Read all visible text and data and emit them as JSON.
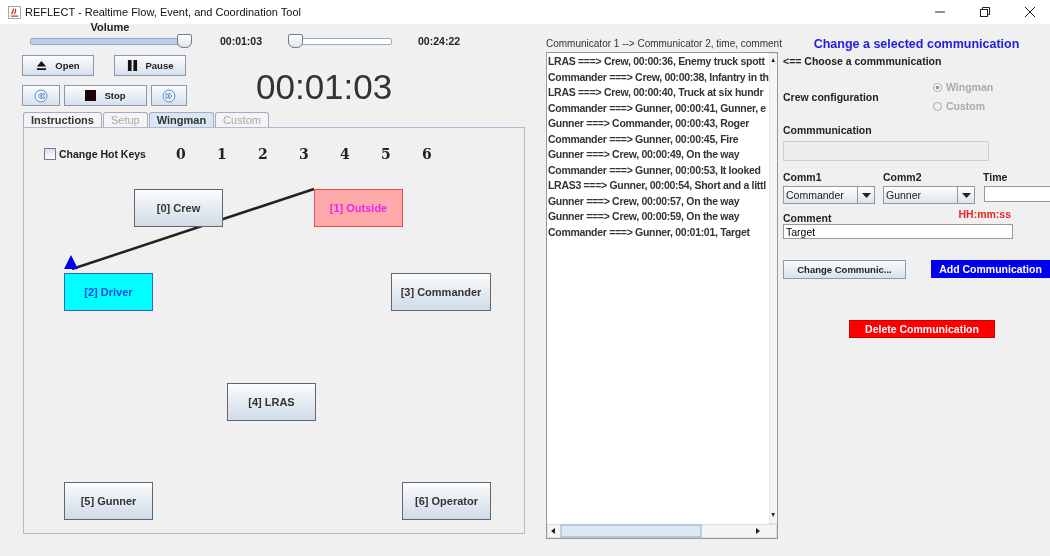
{
  "window": {
    "title": "REFLECT - Realtime Flow, Event, and Coordination Tool"
  },
  "player": {
    "volume": {
      "label": "Volume",
      "level": 0.97
    },
    "position": {
      "level": 0.04
    },
    "elapsed": "00:01:03",
    "total": "00:24:22",
    "clock": "00:01:03",
    "buttons": [
      {
        "kind": "open",
        "label": "Open"
      },
      {
        "kind": "pause",
        "label": "Pause"
      },
      {
        "kind": "rewind"
      },
      {
        "kind": "stop",
        "label": "Stop"
      },
      {
        "kind": "forward"
      }
    ]
  },
  "tabs": [
    {
      "label": "Instructions",
      "selected": false,
      "disabled": false
    },
    {
      "label": "Setup",
      "selected": false,
      "disabled": true
    },
    {
      "label": "Wingman",
      "selected": true,
      "disabled": false
    },
    {
      "label": "Custom",
      "selected": false,
      "disabled": true
    }
  ],
  "hot_keys": {
    "label": "Change Hot Keys",
    "checked": false,
    "keys": [
      "0",
      "1",
      "2",
      "3",
      "4",
      "5",
      "6"
    ]
  },
  "diagram": {
    "nodes": [
      {
        "label": "[0] Crew",
        "kind": "plain"
      },
      {
        "label": "[1] Outside",
        "kind": "source"
      },
      {
        "label": "[2] Driver",
        "kind": "target"
      },
      {
        "label": "[3] Commander",
        "kind": "plain"
      },
      {
        "label": "[4] LRAS",
        "kind": "plain"
      },
      {
        "label": "[5] Gunner",
        "kind": "plain"
      },
      {
        "label": "[6] Operator",
        "kind": "plain"
      }
    ]
  },
  "communications": {
    "header": "Communicator 1 --> Communicator 2, time, comment",
    "items": [
      "LRAS ===> Crew, 00:00:36, Enemy truck spott",
      "Commander ===> Crew, 00:00:38, Infantry in th",
      "LRAS ===> Crew, 00:00:40, Truck at six hundr",
      "Commander ===> Gunner, 00:00:41, Gunner, e",
      "Gunner ===> Commander, 00:00:43, Roger",
      "Commander ===> Gunner, 00:00:45, Fire",
      "Gunner ===> Crew, 00:00:49, On the way",
      "Commander ===> Gunner, 00:00:53, It looked",
      "LRAS3 ===> Gunner, 00:00:54, Short and a littl",
      "Gunner ===> Crew, 00:00:57, On the way",
      "Gunner ===> Crew, 00:00:59, On the way",
      "Commander ===> Gunner, 00:01:01, Target"
    ]
  },
  "editor": {
    "title": "Change a selected communication",
    "hint": "<== Choose a commmunication",
    "crew_label": "Crew configuration",
    "crew_options": [
      {
        "label": "Wingman",
        "selected": true
      },
      {
        "label": "Custom",
        "selected": false
      }
    ],
    "communication_label": "Commmunication",
    "comm1": {
      "label": "Comm1",
      "value": "Commander"
    },
    "comm2": {
      "label": "Comm2",
      "value": "Gunner"
    },
    "time": {
      "label": "Time",
      "format": "HH:mm:ss"
    },
    "comment": {
      "label": "Comment",
      "value": "Target"
    },
    "buttons": [
      {
        "kind": "change",
        "label": "Change Communic..."
      },
      {
        "kind": "add",
        "label": "Add Communication"
      },
      {
        "kind": "delete",
        "label": "Delete Communication"
      }
    ]
  }
}
